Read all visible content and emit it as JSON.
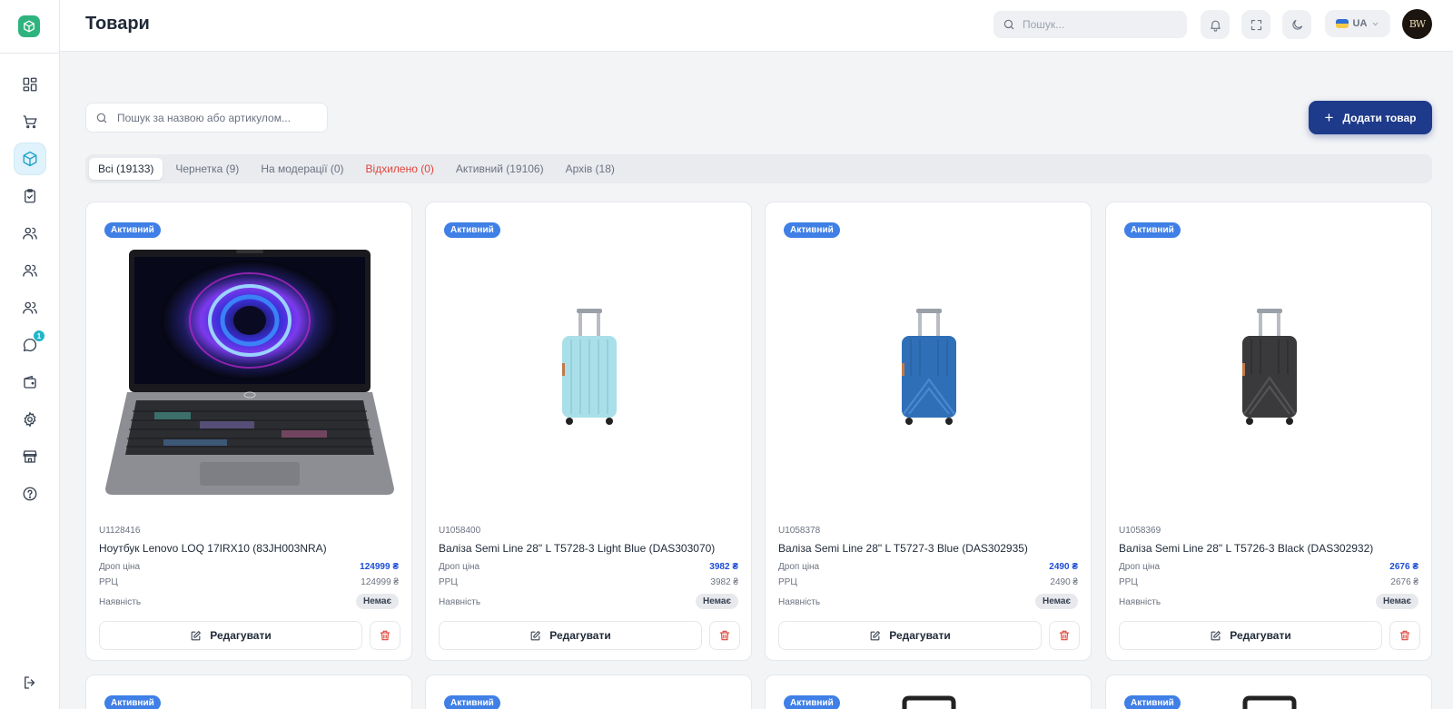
{
  "header": {
    "title": "Товари",
    "search_placeholder": "Пошук...",
    "language": "UA",
    "avatar_initials": "BW"
  },
  "sidebar": {
    "items": [
      {
        "icon": "dashboard-icon",
        "active": false
      },
      {
        "icon": "cart-icon",
        "active": false
      },
      {
        "icon": "box-icon",
        "active": true
      },
      {
        "icon": "clipboard-check-icon",
        "active": false
      },
      {
        "icon": "users-icon",
        "active": false
      },
      {
        "icon": "users-icon",
        "active": false
      },
      {
        "icon": "users-icon",
        "active": false
      },
      {
        "icon": "chat-icon",
        "active": false,
        "badge": "1"
      },
      {
        "icon": "wallet-icon",
        "active": false
      },
      {
        "icon": "gear-icon",
        "active": false
      },
      {
        "icon": "store-icon",
        "active": false
      },
      {
        "icon": "help-icon",
        "active": false
      }
    ],
    "logout_icon": "logout-icon"
  },
  "toolbar": {
    "search_placeholder": "Пошук за назвою або артикулом...",
    "add_label": "Додати товар"
  },
  "tabs": [
    {
      "label": "Всі (19133)",
      "active": true
    },
    {
      "label": "Чернетка (9)"
    },
    {
      "label": "На модерації (0)"
    },
    {
      "label": "Відхилено (0)",
      "danger": true
    },
    {
      "label": "Активний (19106)"
    },
    {
      "label": "Архів (18)"
    }
  ],
  "labels": {
    "drop_price": "Дроп ціна",
    "rrp": "РРЦ",
    "availability": "Наявність",
    "edit": "Редагувати"
  },
  "products": [
    {
      "status": "Активний",
      "sku": "U1128416",
      "name": "Ноутбук Lenovo LOQ 17IRX10 (83JH003NRA)",
      "drop_price": "124999 ₴",
      "rrp": "124999 ₴",
      "availability": "Немає",
      "image": "laptop"
    },
    {
      "status": "Активний",
      "sku": "U1058400",
      "name": "Валіза Semi Line 28\" L T5728-3 Light Blue (DAS303070)",
      "drop_price": "3982 ₴",
      "rrp": "3982 ₴",
      "availability": "Немає",
      "image": "suitcase",
      "color": "#a9dfe9"
    },
    {
      "status": "Активний",
      "sku": "U1058378",
      "name": "Валіза Semi Line 28\" L T5727-3 Blue (DAS302935)",
      "drop_price": "2490 ₴",
      "rrp": "2490 ₴",
      "availability": "Немає",
      "image": "suitcase",
      "color": "#2f6fb7"
    },
    {
      "status": "Активний",
      "sku": "U1058369",
      "name": "Валіза Semi Line 28\" L T5726-3 Black (DAS302932)",
      "drop_price": "2676 ₴",
      "rrp": "2676 ₴",
      "availability": "Немає",
      "image": "suitcase",
      "color": "#3a3a3c"
    }
  ],
  "row2_status": [
    "Активний",
    "Активний",
    "Активний",
    "Активний"
  ],
  "colors": {
    "brand": "#2fb37e",
    "primary": "#1e3a8a",
    "status_active": "#3f7fe6",
    "drop_price": "#1d4ed8",
    "danger": "#e0453a"
  }
}
